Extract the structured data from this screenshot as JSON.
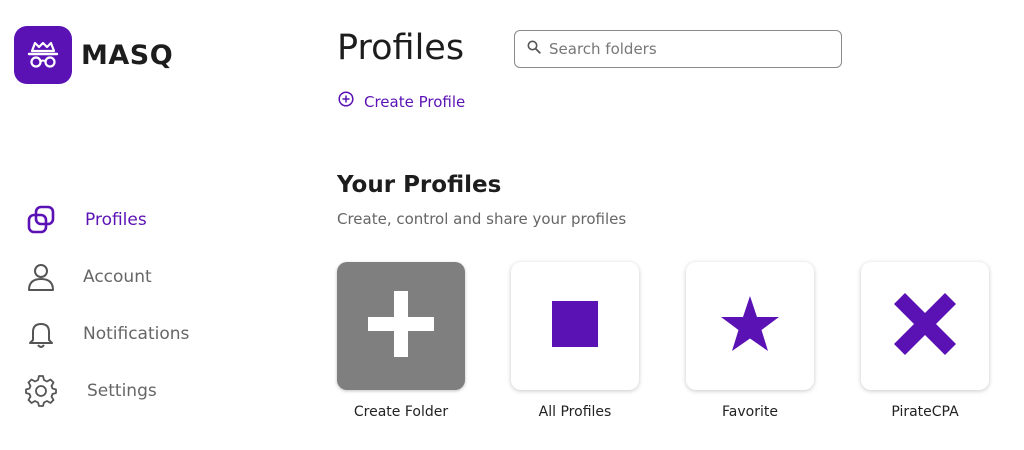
{
  "app": {
    "name": "MASQ"
  },
  "colors": {
    "accent": "#5a12b5",
    "tile_gray": "#7f7f7f",
    "muted_text": "#666666"
  },
  "sidebar": {
    "items": [
      {
        "label": "Profiles",
        "icon": "profiles-icon",
        "active": true
      },
      {
        "label": "Account",
        "icon": "user-icon",
        "active": false
      },
      {
        "label": "Notifications",
        "icon": "bell-icon",
        "active": false
      },
      {
        "label": "Settings",
        "icon": "gear-icon",
        "active": false
      }
    ]
  },
  "header": {
    "title": "Profiles",
    "search_placeholder": "Search folders",
    "create_profile_label": "Create Profile"
  },
  "section": {
    "title": "Your Profiles",
    "subtitle": "Create, control and share your profiles"
  },
  "folders": [
    {
      "label": "Create Folder",
      "icon": "plus-icon"
    },
    {
      "label": "All Profiles",
      "icon": "square-icon"
    },
    {
      "label": "Favorite",
      "icon": "star-icon"
    },
    {
      "label": "PirateCPA",
      "icon": "x-icon"
    }
  ]
}
